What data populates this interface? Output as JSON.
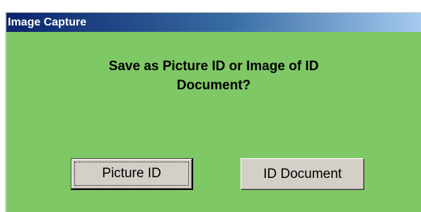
{
  "window": {
    "title": "Image Capture"
  },
  "dialog": {
    "question_line1": "Save as Picture ID or Image of ID",
    "question_line2": "Document?"
  },
  "buttons": {
    "picture_id_label": "Picture ID",
    "id_document_label": "ID Document"
  },
  "colors": {
    "dialog_background": "#7fc866",
    "titlebar_start": "#0a246a",
    "titlebar_end": "#a6caf0",
    "button_face": "#d4d0c8"
  }
}
